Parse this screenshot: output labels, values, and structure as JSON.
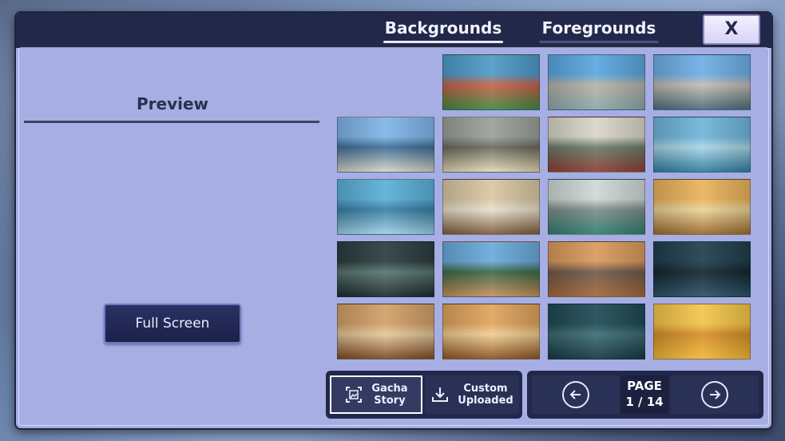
{
  "tabs": [
    {
      "label": "Backgrounds",
      "active": true
    },
    {
      "label": "Foregrounds",
      "active": false
    }
  ],
  "close_label": "X",
  "preview": {
    "title": "Preview",
    "fullscreen_label": "Full Screen"
  },
  "thumbnails": [
    {
      "name": "tree-lined-brick-path",
      "colors": [
        "#4f9ac9",
        "#3f8a3e",
        "#c7634a"
      ]
    },
    {
      "name": "rooftop-fence-sea",
      "colors": [
        "#5aa7e0",
        "#8aa7a6",
        "#b7b3a8"
      ]
    },
    {
      "name": "rooftop-fence-clouds",
      "colors": [
        "#6eaee6",
        "#4e6b78",
        "#c2bcb4"
      ]
    },
    {
      "name": "school-entrance",
      "colors": [
        "#7fb5e8",
        "#d8d4c7",
        "#3f6f97"
      ]
    },
    {
      "name": "classroom",
      "colors": [
        "#9aa09a",
        "#e2d9b6",
        "#6c6a5d"
      ]
    },
    {
      "name": "hallway-red-floor",
      "colors": [
        "#d9d6c8",
        "#8c3e33",
        "#6b7c6a"
      ]
    },
    {
      "name": "hallway-blue",
      "colors": [
        "#6fb5d9",
        "#2e7d9e",
        "#a9d5e6"
      ]
    },
    {
      "name": "stairwell",
      "colors": [
        "#5ab0d8",
        "#9fd1e4",
        "#3a7fa5"
      ]
    },
    {
      "name": "hallway-long-warm",
      "colors": [
        "#d9c7a3",
        "#7b5a3b",
        "#e9e0cc"
      ]
    },
    {
      "name": "hallway-green-floor",
      "colors": [
        "#cfd8d5",
        "#2f7e6e",
        "#7d8f8a"
      ]
    },
    {
      "name": "hallway-evening",
      "colors": [
        "#e9b25a",
        "#9a6a2c",
        "#ecd39a"
      ]
    },
    {
      "name": "hallway-night",
      "colors": [
        "#2b3d3f",
        "#1c2a2c",
        "#5a7670"
      ]
    },
    {
      "name": "courtyard-day",
      "colors": [
        "#6aa9da",
        "#c88f5b",
        "#3c6a48"
      ]
    },
    {
      "name": "courtyard-sunset",
      "colors": [
        "#d99a5c",
        "#a3683a",
        "#6f5a4a"
      ]
    },
    {
      "name": "courtyard-night",
      "colors": [
        "#1f3e4c",
        "#2b5366",
        "#13262f"
      ]
    },
    {
      "name": "gym-day",
      "colors": [
        "#d2a067",
        "#7a4a25",
        "#e6c89b"
      ]
    },
    {
      "name": "gym-evening",
      "colors": [
        "#e0a35c",
        "#8a5423",
        "#f1cf93"
      ]
    },
    {
      "name": "gym-night",
      "colors": [
        "#1f4a55",
        "#163840",
        "#3d6d74"
      ]
    },
    {
      "name": "lockers",
      "colors": [
        "#f4c54a",
        "#f0b93a",
        "#d68f28"
      ]
    }
  ],
  "source_buttons": [
    {
      "label": "Gacha\nStory",
      "icon": "image-frame-icon",
      "selected": true
    },
    {
      "label": "Custom\nUploaded",
      "icon": "download-icon",
      "selected": false
    }
  ],
  "pagination": {
    "label": "PAGE",
    "current": "1 / 14"
  }
}
